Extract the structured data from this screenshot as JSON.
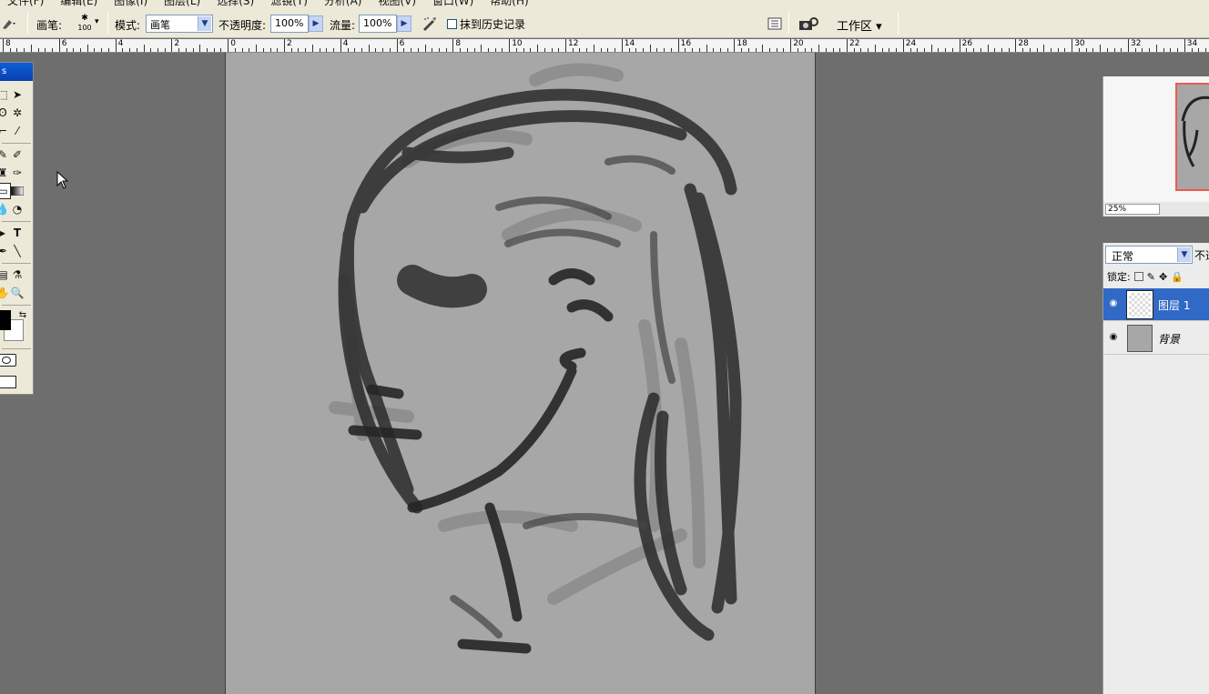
{
  "menubar": {
    "items": [
      "文件(F)",
      "编辑(E)",
      "图像(I)",
      "图层(L)",
      "选择(S)",
      "滤镜(T)",
      "分析(A)",
      "视图(V)",
      "窗口(W)",
      "帮助(H)"
    ]
  },
  "options": {
    "brush_label": "画笔:",
    "brush_size": "100",
    "mode_label": "模式:",
    "mode_value": "画笔",
    "opacity_label": "不透明度:",
    "opacity_value": "100%",
    "flow_label": "流量:",
    "flow_value": "100%",
    "history_label": "抹到历史记录",
    "workspace_label": "工作区 ▾"
  },
  "ruler": {
    "labels": [
      "8",
      "6",
      "4",
      "2",
      "0",
      "2",
      "4",
      "6",
      "8",
      "10",
      "12",
      "14",
      "16",
      "18",
      "20",
      "22",
      "24",
      "26",
      "28",
      "30",
      "32",
      "34"
    ]
  },
  "tools": {
    "title": "s",
    "icons": [
      "move-tool-icon",
      "lasso-tool-icon",
      "magic-wand-icon",
      "crop-tool-icon",
      "slice-tool-icon",
      "healing-brush-icon",
      "brush-tool-icon",
      "clone-stamp-icon",
      "history-brush-icon",
      "eraser-icon",
      "gradient-tool-icon",
      "blur-tool-icon",
      "dodge-tool-icon",
      "pen-tool-icon",
      "type-tool-icon",
      "path-select-icon",
      "line-tool-icon",
      "notes-tool-icon",
      "eyedropper-icon",
      "hand-tool-icon",
      "zoom-tool-icon"
    ],
    "type_glyph": "T"
  },
  "navigator": {
    "zoom": "25%"
  },
  "layers": {
    "blend_mode": "正常",
    "opacity_label": "不透",
    "lock_label": "锁定:",
    "items": [
      {
        "name": "图层 1",
        "selected": true
      },
      {
        "name": "背景",
        "selected": false
      }
    ]
  },
  "colors": {
    "accent": "#3169c6",
    "panel_bg": "#ece9d8",
    "canvas": "#a7a7a7",
    "workspace": "#6e6e6e",
    "nav_frame": "#ef5a4c"
  }
}
